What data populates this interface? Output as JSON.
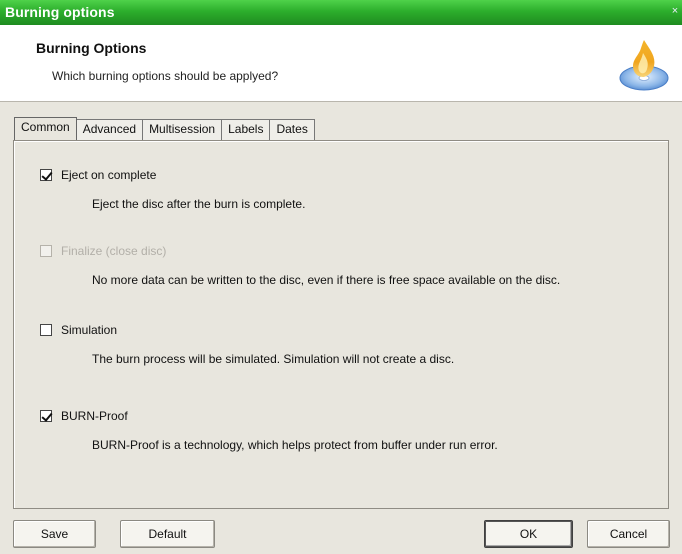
{
  "window": {
    "title": "Burning options"
  },
  "header": {
    "title": "Burning Options",
    "subtitle": "Which burning options should be applyed?"
  },
  "tabs": [
    {
      "label": "Common",
      "active": true
    },
    {
      "label": "Advanced",
      "active": false
    },
    {
      "label": "Multisession",
      "active": false
    },
    {
      "label": "Labels",
      "active": false
    },
    {
      "label": "Dates",
      "active": false
    }
  ],
  "options": [
    {
      "label": "Eject on complete",
      "description": "Eject the disc after the burn is complete.",
      "checked": true,
      "enabled": true
    },
    {
      "label": "Finalize (close disc)",
      "description": "No more data can be written to the disc, even if there is free space available on the disc.",
      "checked": false,
      "enabled": false
    },
    {
      "label": "Simulation",
      "description": "The burn process will be simulated. Simulation will not create a disc.",
      "checked": false,
      "enabled": true
    },
    {
      "label": "BURN-Proof",
      "description": "BURN-Proof is a technology, which helps protect from buffer under run error.",
      "checked": true,
      "enabled": true
    }
  ],
  "buttons": {
    "save": "Save",
    "default": "Default",
    "ok": "OK",
    "cancel": "Cancel"
  },
  "icons": {
    "close": "close-icon",
    "logo": "burning-disc-icon"
  },
  "colors": {
    "titlebar": "#2cae2c",
    "header_bg": "#ffffff",
    "panel_bg": "#e8e6de",
    "disabled_text": "#b2afa8"
  }
}
